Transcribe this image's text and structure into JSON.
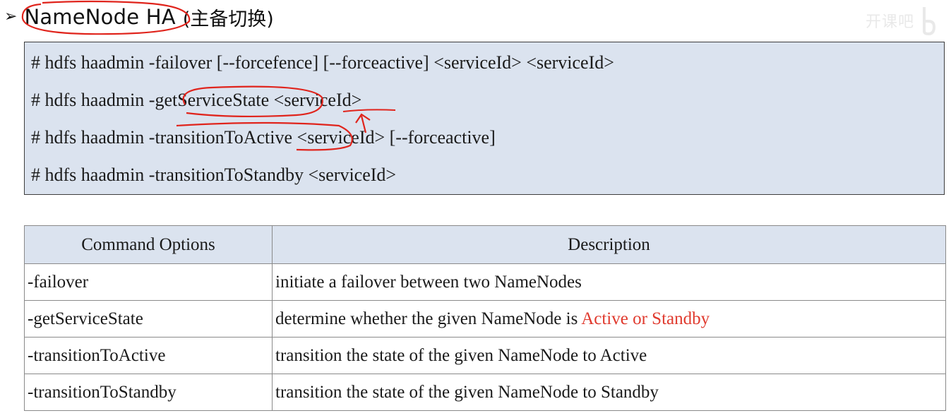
{
  "heading": {
    "bullet": "➢",
    "title_main": "NameNode HA",
    "title_sub": "(主备切换)"
  },
  "watermark": {
    "text": "开课吧",
    "icon": "b-logo-icon"
  },
  "commands": [
    "# hdfs haadmin -failover [--forcefence] [--forceactive] <serviceId> <serviceId>",
    "# hdfs haadmin -getServiceState <serviceId>",
    "# hdfs haadmin -transitionToActive <serviceId> [--forceactive]",
    "# hdfs haadmin -transitionToStandby <serviceId>"
  ],
  "table": {
    "headers": [
      "Command Options",
      "Description"
    ],
    "rows": [
      {
        "option": "-failover",
        "description": "initiate a failover between two NameNodes",
        "description_highlight": ""
      },
      {
        "option": "-getServiceState",
        "description": "determine whether the given NameNode is ",
        "description_highlight": "Active or Standby"
      },
      {
        "option": "-transitionToActive",
        "description": "transition the state of the given NameNode to Active",
        "description_highlight": ""
      },
      {
        "option": "-transitionToStandby",
        "description": "transition the state of the given NameNode to Standby",
        "description_highlight": ""
      }
    ]
  },
  "colors": {
    "box_fill": "#dbe3ef",
    "highlight": "#e03a2e",
    "annotation_ink": "#e0241c"
  }
}
